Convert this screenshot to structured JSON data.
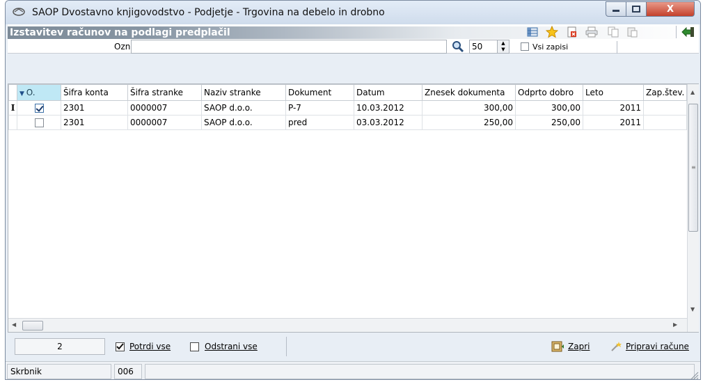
{
  "window": {
    "title": "SAOP Dvostavno knjigovodstvo - Podjetje - Trgovina na debelo in drobno",
    "close_glyph": "X"
  },
  "form": {
    "title": "Izstavitev računov na podlagi predplačil",
    "toolbar_icons": [
      "table-icon",
      "star-icon",
      "delete-icon",
      "printer-icon",
      "copy-icon",
      "paste-icon",
      "exit-icon"
    ]
  },
  "filter": {
    "label": "Ozn",
    "value": "",
    "count": "50",
    "all_records_label": "Vsi zapisi"
  },
  "grid": {
    "columns": [
      "O.",
      "Šifra konta",
      "Šifra stranke",
      "Naziv stranke",
      "Dokument",
      "Datum",
      "Znesek dokumenta",
      "Odprto dobro",
      "Leto",
      "Zap.štev."
    ],
    "rows": [
      {
        "marker": "I",
        "checked": true,
        "konto": "2301",
        "stranka": "0000007",
        "naziv": "SAOP d.o.o.",
        "dokument": "P-7",
        "datum": "10.03.2012",
        "znesek": "300,00",
        "odprto": "300,00",
        "leto": "2011",
        "zap": ""
      },
      {
        "marker": "",
        "checked": false,
        "konto": "2301",
        "stranka": "0000007",
        "naziv": "SAOP d.o.o.",
        "dokument": "pred",
        "datum": "03.03.2012",
        "znesek": "250,00",
        "odprto": "250,00",
        "leto": "2011",
        "zap": ""
      }
    ]
  },
  "bottom": {
    "count": "2",
    "confirm_all": "Potrdi vse",
    "remove_all": "Odstrani vse",
    "close_btn": "Zapri",
    "prepare_btn": "Pripravi račune"
  },
  "status": {
    "field_label": "Skrbnik",
    "field_value": "006"
  },
  "colors": {
    "header_gradient_start": "#7d8b98",
    "sorted_column": "#bfe8f5"
  }
}
